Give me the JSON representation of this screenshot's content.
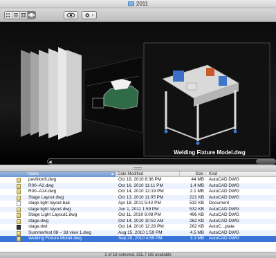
{
  "window": {
    "title": "2011"
  },
  "toolbar": {
    "view_icons": [
      "icon-view-icon",
      "list-view-icon",
      "column-view-icon",
      "coverflow-view-icon"
    ],
    "quicklook_icon": "eye-icon",
    "action_icon": "gear-icon"
  },
  "coverflow": {
    "caption": "Welding Fixture Model.dwg"
  },
  "list": {
    "headers": {
      "name": "Name",
      "date": "Date Modified",
      "size": "Size",
      "kind": "Kind"
    },
    "rows": [
      {
        "name": "pavillion9.dwg",
        "date": "Oct 18, 2010 8:36 PM",
        "size": "44 MB",
        "kind": "AutoCAD DWG",
        "icon": "dwg"
      },
      {
        "name": "R00–A2.dwg",
        "date": "Oct 16, 2010 11:11 PM",
        "size": "1.4 MB",
        "kind": "AutoCAD DWG",
        "icon": "dwg"
      },
      {
        "name": "R00–A14.dwg",
        "date": "Oct 14, 2010 12:19 PM",
        "size": "2.1 MB",
        "kind": "AutoCAD DWG",
        "icon": "dwg"
      },
      {
        "name": "Stage Layout.dwg",
        "date": "Oct 13, 2010 11:05 PM",
        "size": "221 KB",
        "kind": "AutoCAD DWG",
        "icon": "dwg"
      },
      {
        "name": "stage light layout.bak",
        "date": "Apr 18, 2011 5:42 PM",
        "size": "532 KB",
        "kind": "Document",
        "icon": "doc"
      },
      {
        "name": "stage light layout.dwg",
        "date": "Jun 1, 2011 1:59 PM",
        "size": "532 KB",
        "kind": "AutoCAD DWG",
        "icon": "dwg"
      },
      {
        "name": "Stage Light Layout1.dwg",
        "date": "Oct 11, 2010 6:08 PM",
        "size": "496 KB",
        "kind": "AutoCAD DWG",
        "icon": "dwg"
      },
      {
        "name": "stage.dwg",
        "date": "Oct 14, 2010 10:52 AM",
        "size": "262 KB",
        "kind": "AutoCAD DWG",
        "icon": "dwg"
      },
      {
        "name": "stage.dwt",
        "date": "Oct 14, 2010 12:28 PM",
        "size": "262 KB",
        "kind": "AutoC...plate",
        "icon": "dwt"
      },
      {
        "name": "Summerfest 08 – 3d view 1.dwg",
        "date": "Aug 15, 2010 1:59 PM",
        "size": "4.5 MB",
        "kind": "AutoCAD DWG",
        "icon": "dwg"
      },
      {
        "name": "Welding Fixture Model.dwg",
        "date": "Sep 20, 2010 4:59 PM",
        "size": "3.3 MB",
        "kind": "AutoCAD DWG",
        "icon": "dwg",
        "selected": true
      }
    ]
  },
  "status": {
    "text": "1 of 18 selected, 355.7 GB available"
  },
  "colors": {
    "selection": "#3875d7",
    "alt_row": "#edf3fe",
    "coverflow_bg": "#000000"
  }
}
